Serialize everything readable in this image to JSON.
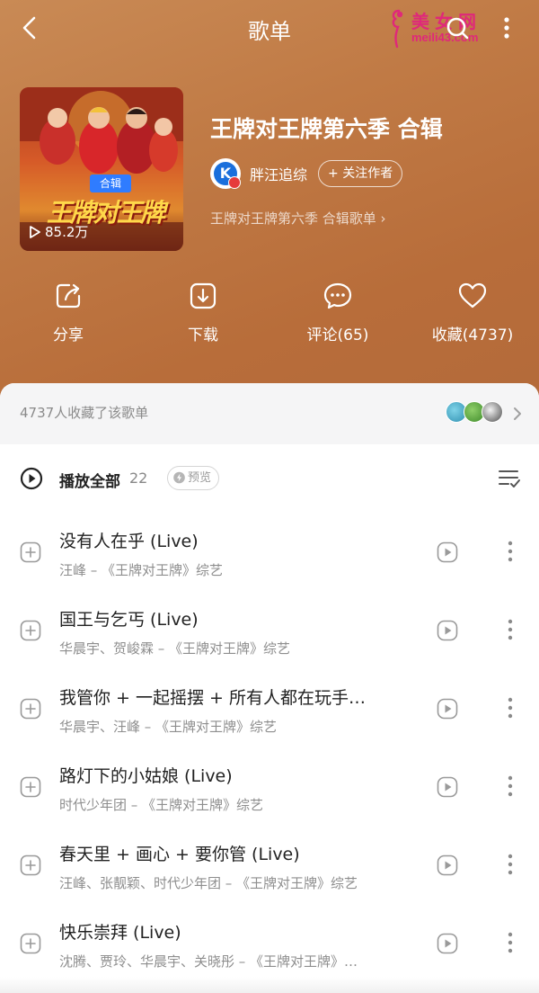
{
  "nav": {
    "title": "歌单",
    "watermark_cn": "美女网",
    "watermark_en": "meili43.com"
  },
  "playlist": {
    "cover_badge": "合辑",
    "cover_logo": "王牌对王牌",
    "play_count": "85.2万",
    "title": "王牌对王牌第六季 合辑",
    "author_initial": "K",
    "author_name": "胖汪追综",
    "follow_label": "+ 关注作者",
    "subtitle": "王牌对王牌第六季 合辑歌单 ›"
  },
  "actions": [
    {
      "label": "分享",
      "icon": "share-icon"
    },
    {
      "label": "下载",
      "icon": "download-icon"
    },
    {
      "label": "评论(65)",
      "icon": "comment-icon"
    },
    {
      "label": "收藏(4737)",
      "icon": "heart-icon"
    }
  ],
  "favorites": {
    "text": "4737人收藏了该歌单"
  },
  "play_all": {
    "label": "播放全部",
    "count": "22",
    "preview_label": "预览"
  },
  "songs": [
    {
      "title": "没有人在乎 (Live)",
      "meta": "汪峰 – 《王牌对王牌》综艺"
    },
    {
      "title": "国王与乞丐 (Live)",
      "meta": "华晨宇、贺峻霖 – 《王牌对王牌》综艺"
    },
    {
      "title": "我管你 + 一起摇摆 + 所有人都在玩手…",
      "meta": "华晨宇、汪峰 – 《王牌对王牌》综艺"
    },
    {
      "title": "路灯下的小姑娘 (Live)",
      "meta": "时代少年团 – 《王牌对王牌》综艺"
    },
    {
      "title": "春天里 + 画心 + 要你管 (Live)",
      "meta": "汪峰、张靓颖、时代少年团 – 《王牌对王牌》综艺"
    },
    {
      "title": "快乐崇拜 (Live)",
      "meta": "沈腾、贾玲、华晨宇、关晓彤 – 《王牌对王牌》…"
    }
  ],
  "colors": {
    "hero_gradient_start": "#c98a55",
    "hero_gradient_end": "#b36a3a",
    "preview_badge_blue": "#2f7cff",
    "watermark_pink": "#e0287a"
  }
}
